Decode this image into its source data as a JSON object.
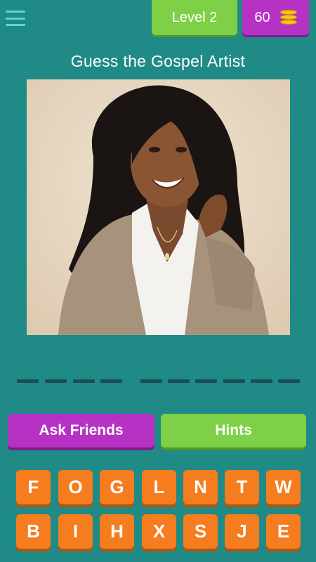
{
  "header": {
    "level_label": "Level 2",
    "coins": "60",
    "coin_icon": "coin-stack-icon",
    "menu_icon": "hamburger-menu-icon"
  },
  "question": {
    "title": "Guess the Gospel Artist"
  },
  "answer": {
    "word_lengths": [
      4,
      6
    ]
  },
  "actions": {
    "ask_friends": "Ask Friends",
    "hints": "Hints"
  },
  "keyboard": {
    "row1": [
      "F",
      "O",
      "G",
      "L",
      "N",
      "T",
      "W"
    ],
    "row2": [
      "B",
      "I",
      "H",
      "X",
      "S",
      "J",
      "E"
    ]
  },
  "colors": {
    "background": "#1f8a86",
    "green": "#7ed046",
    "purple": "#b632c4",
    "orange": "#f57c1f"
  }
}
